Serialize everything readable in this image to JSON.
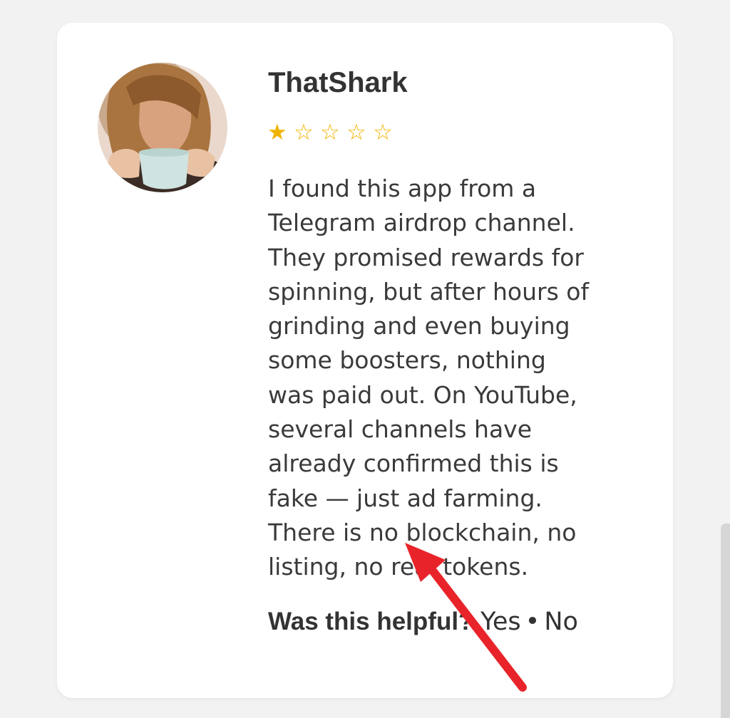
{
  "review": {
    "author": "ThatShark",
    "rating": 1,
    "max_rating": 5,
    "stars": [
      "★",
      "☆",
      "☆",
      "☆",
      "☆"
    ],
    "lines": [
      "I found this app from a",
      "Telegram airdrop channel.",
      "They promised rewards for",
      "spinning, but after hours of",
      "grinding and even buying",
      "some boosters, nothing",
      "was paid out. On YouTube,",
      "several channels have",
      "already confirmed this is",
      "fake — just ad farming.",
      "There is no blockchain, no",
      "listing, no real tokens."
    ]
  },
  "helpful": {
    "question": "Was this helpful?",
    "yes": "Yes",
    "separator": "•",
    "no": "No"
  },
  "colors": {
    "star": "#f0b400",
    "arrow": "#e8242a",
    "card": "#ffffff",
    "background": "#f2f2f2"
  },
  "icons": {
    "avatar": "avatar-photo",
    "annotation": "red-arrow-icon"
  }
}
